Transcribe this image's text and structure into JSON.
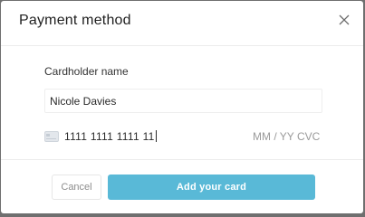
{
  "dialog": {
    "title": "Payment method",
    "close_icon": "close-icon"
  },
  "form": {
    "cardholder_label": "Cardholder name",
    "cardholder_value": "Nicole Davies",
    "card_icon": "credit-card-icon",
    "card_number": "1111 1111 1111 11",
    "expiry_placeholder": "MM / YY",
    "cvc_placeholder": "CVC"
  },
  "footer": {
    "cancel_label": "Cancel",
    "submit_label": "Add your card"
  },
  "colors": {
    "accent": "#59b9d7",
    "overlay": "#6f6f6f",
    "placeholder": "#9a9a9a"
  }
}
